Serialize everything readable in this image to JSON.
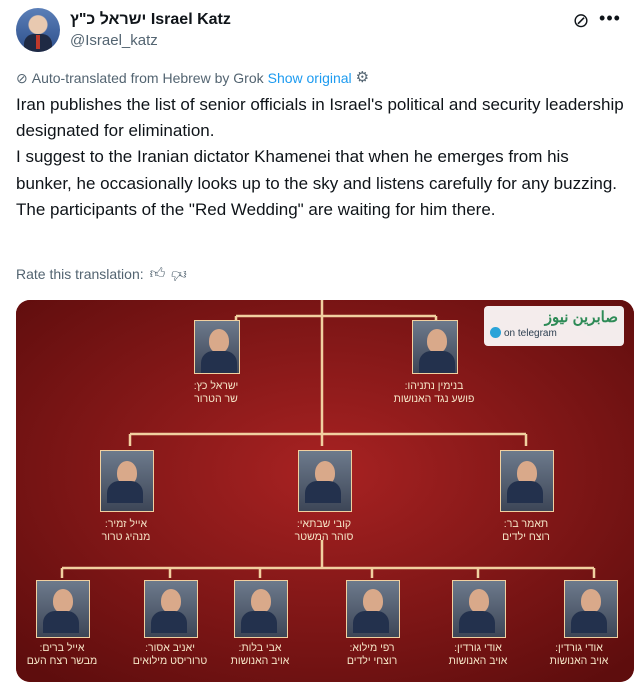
{
  "post": {
    "display_name": "ישראל כ\"ץ Israel Katz",
    "handle": "@Israel_katz",
    "translation_note": "Auto-translated from Hebrew by Grok",
    "show_original": "Show original",
    "paragraphs": [
      "Iran publishes the list of senior officials in Israel's political and security leadership designated for elimination.",
      "I suggest to the Iranian dictator Khamenei that when he emerges from his bunker, he occasionally looks up to the sky and listens carefully for any buzzing.",
      "The participants of the \"Red Wedding\" are waiting for him there."
    ],
    "rate_label": "Rate this translation:"
  },
  "icons": {
    "grok": "grok-slash-icon",
    "more": "more-dots-icon",
    "translate": "translate-slash-icon",
    "settings": "gear-icon",
    "thumb_up": "thumb-up-icon",
    "thumb_down": "thumb-down-icon"
  },
  "colors": {
    "accent": "#1d9bf0",
    "muted": "#536471",
    "text": "#0f1419",
    "image_bg": "#8e1a1a",
    "image_lines": "#f1d0a0"
  },
  "image": {
    "logo_arabic": "صابرين نيوز",
    "logo_telegram": "on telegram",
    "people": [
      {
        "name": "ישראל כץ:",
        "title": "שר הטרור"
      },
      {
        "name": "בנימין נתניהו:",
        "title": "פושע נגד האנושות"
      },
      {
        "name": "אייל זמיר:",
        "title": "מנהיג טרור"
      },
      {
        "name": "קובי שבתאי:",
        "title": "סוהר המשטר"
      },
      {
        "name": "תאמר בר:",
        "title": "רוצח ילדים"
      },
      {
        "name": "אייל ברים:",
        "title": "מבשר רצח העם"
      },
      {
        "name": "יאניב אסור:",
        "title": "טרוריסט מילואים"
      },
      {
        "name": "אבי בלות:",
        "title": "אויב האנושות"
      },
      {
        "name": "רפי מילוא:",
        "title": "רוצחי ילדים"
      },
      {
        "name": "אודי גורדין:",
        "title": "אויב האנושות"
      },
      {
        "name": "אודי גורדין:",
        "title": "אויב האנושות"
      }
    ]
  }
}
